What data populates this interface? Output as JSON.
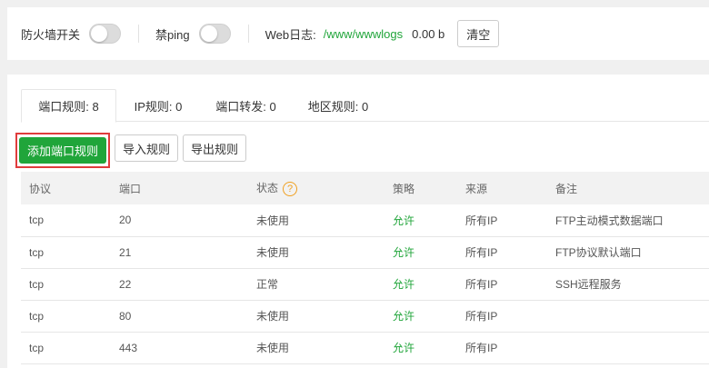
{
  "topbar": {
    "firewall_label": "防火墙开关",
    "firewall_on": false,
    "ping_label": "禁ping",
    "ping_on": false,
    "weblog_label": "Web日志:",
    "weblog_path": "/www/wwwlogs",
    "weblog_size": "0.00 b",
    "clear_label": "清空"
  },
  "tabs": [
    {
      "label": "端口规则: 8",
      "active": true
    },
    {
      "label": "IP规则: 0",
      "active": false
    },
    {
      "label": "端口转发: 0",
      "active": false
    },
    {
      "label": "地区规则: 0",
      "active": false
    }
  ],
  "toolbar": {
    "add_label": "添加端口规则",
    "import_label": "导入规则",
    "export_label": "导出规则"
  },
  "table": {
    "headers": [
      "协议",
      "端口",
      "状态",
      "策略",
      "来源",
      "备注"
    ],
    "status_help_icon": "question-circle-icon",
    "rows": [
      {
        "protocol": "tcp",
        "port": "20",
        "status": "未使用",
        "policy": "允许",
        "source": "所有IP",
        "note": "FTP主动模式数据端口"
      },
      {
        "protocol": "tcp",
        "port": "21",
        "status": "未使用",
        "policy": "允许",
        "source": "所有IP",
        "note": "FTP协议默认端口"
      },
      {
        "protocol": "tcp",
        "port": "22",
        "status": "正常",
        "policy": "允许",
        "source": "所有IP",
        "note": "SSH远程服务"
      },
      {
        "protocol": "tcp",
        "port": "80",
        "status": "未使用",
        "policy": "允许",
        "source": "所有IP",
        "note": ""
      },
      {
        "protocol": "tcp",
        "port": "443",
        "status": "未使用",
        "policy": "允许",
        "source": "所有IP",
        "note": ""
      }
    ]
  },
  "colors": {
    "accent_green": "#20a53a",
    "highlight_red": "#e03c3c",
    "help_orange": "#f0a020"
  }
}
